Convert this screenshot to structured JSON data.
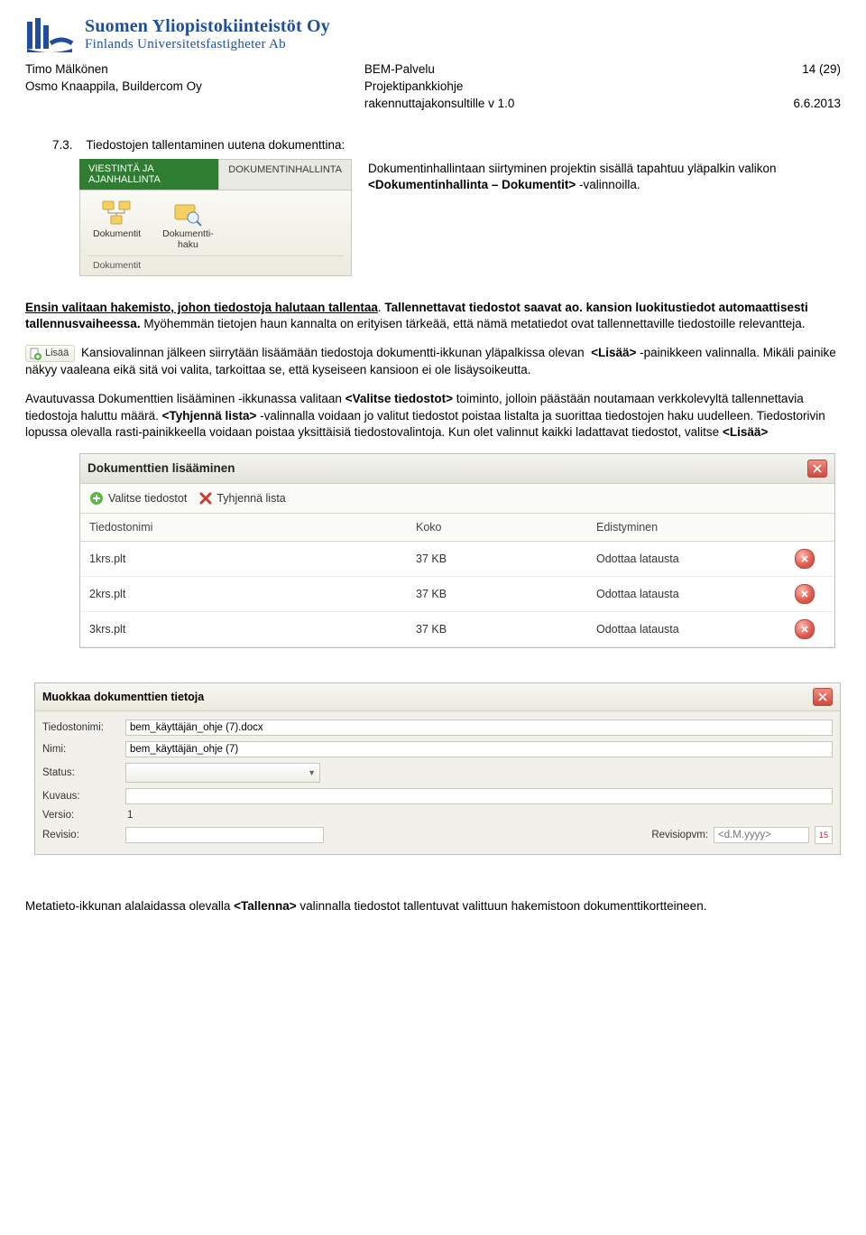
{
  "logo": {
    "fi": "Suomen Yliopistokiinteistöt Oy",
    "sv": "Finlands Universitetsfastigheter Ab"
  },
  "header": {
    "left1": "Timo Mälkönen",
    "left2": "Osmo Knaappila, Buildercom Oy",
    "mid1": "BEM-Palvelu",
    "mid2": "Projektipankkiohje",
    "mid3": "rakennuttajakonsultille v 1.0",
    "page": "14 (29)",
    "date": "6.6.2013"
  },
  "section": {
    "num": "7.3.",
    "title": "Tiedostojen tallentaminen uutena dokumenttina:"
  },
  "ribbon": {
    "tab_active": "VIESTINTÄ JA AJANHALLINTA",
    "tab_other": "DOKUMENTINHALLINTA",
    "btn1": "Dokumentit",
    "btn2a": "Dokumentti-",
    "btn2b": "haku",
    "group": "Dokumentit"
  },
  "intro": {
    "p1a": "Dokumentinhallintaan siirtyminen projektin sisällä tapahtuu yläpalkin valikon ",
    "p1b": "<Dokumentinhallinta – Dokumentit>",
    "p1c": " -valinnoilla."
  },
  "para2a": "Ensin valitaan hakemisto, johon tiedostoja halutaan tallentaa",
  "para2b": ". ",
  "para2c": "Tallennettavat tiedostot saavat ao. kansion luokitustiedot automaattisesti tallennusvaiheessa.",
  "para2d": " Myöhemmän tietojen haun kannalta on erityisen tärkeää, että nämä metatiedot ovat tallennettaville tiedostoille relevantteja.",
  "lisaa_chip": "Lisää",
  "para3": "Kansiovalinnan jälkeen siirrytään lisäämään tiedostoja dokumentti-ikkunan yläpalkissa olevan  <Lisää> -painikkeen valinnalla. Mikäli painike näkyy vaaleana eikä sitä voi valita, tarkoittaa se, että kyseiseen kansioon ei ole lisäysoikeutta.",
  "para4": "Avautuvassa Dokumenttien lisääminen -ikkunassa valitaan <Valitse tiedostot> toiminto, jolloin päästään noutamaan verkkolevyltä tallennettavia tiedostoja haluttu määrä. <Tyhjennä lista> -valinnalla voidaan jo valitut tiedostot poistaa listalta ja suorittaa tiedostojen haku uudelleen. Tiedostorivin lopussa olevalla rasti-painikkeella voidaan poistaa yksittäisiä tiedostovalintoja. Kun olet valinnut kaikki ladattavat tiedostot, valitse <Lisää>",
  "dlg": {
    "title": "Dokumenttien lisääminen",
    "valitse": "Valitse tiedostot",
    "tyhjenna": "Tyhjennä lista",
    "cols": {
      "name": "Tiedostonimi",
      "size": "Koko",
      "prog": "Edistyminen"
    },
    "rows": [
      {
        "name": "1krs.plt",
        "size": "37 KB",
        "prog": "Odottaa latausta"
      },
      {
        "name": "2krs.plt",
        "size": "37 KB",
        "prog": "Odottaa latausta"
      },
      {
        "name": "3krs.plt",
        "size": "37 KB",
        "prog": "Odottaa latausta"
      }
    ]
  },
  "meta": {
    "title": "Muokkaa dokumenttien tietoja",
    "labels": {
      "tiedostonimi": "Tiedostonimi:",
      "nimi": "Nimi:",
      "status": "Status:",
      "kuvaus": "Kuvaus:",
      "versio": "Versio:",
      "revisio": "Revisio:",
      "revisiopvm": "Revisiopvm:"
    },
    "values": {
      "tiedostonimi": "bem_käyttäjän_ohje (7).docx",
      "nimi": "bem_käyttäjän_ohje (7)",
      "versio": "1",
      "revisiopvm_placeholder": "<d.M.yyyy>"
    },
    "cal_label": "15"
  },
  "footer": "Metatieto-ikkunan alalaidassa olevalla <Tallenna> valinnalla tiedostot tallentuvat valittuun hakemistoon dokumenttikortteineen."
}
